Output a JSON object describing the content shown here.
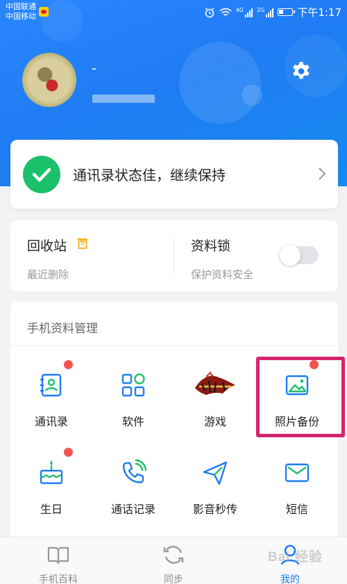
{
  "status_bar": {
    "carrier_1": "中国联通",
    "carrier_2": "中国移动",
    "net_1": "4G",
    "net_2": "2G",
    "time": "下午1:17"
  },
  "profile": {
    "username": "-",
    "settings_icon": "gear-icon"
  },
  "status_card": {
    "text": "通讯录状态佳，继续保持",
    "accent": "#1cc06b"
  },
  "utilities": {
    "recycle": {
      "title": "回收站",
      "subtitle": "最近删除",
      "icon": "trash-icon",
      "icon_color": "#f5b623"
    },
    "lock": {
      "title": "资料锁",
      "subtitle": "保护资料安全",
      "enabled": false
    }
  },
  "management": {
    "title": "手机资料管理",
    "items": [
      {
        "label": "通讯录",
        "icon": "contacts-icon",
        "badge": true
      },
      {
        "label": "软件",
        "icon": "apps-icon",
        "badge": false
      },
      {
        "label": "游戏",
        "icon": "game-logo-icon",
        "badge": false
      },
      {
        "label": "照片备份",
        "icon": "photo-icon",
        "badge": true
      },
      {
        "label": "生日",
        "icon": "birthday-cake-icon",
        "badge": true
      },
      {
        "label": "通话记录",
        "icon": "phone-icon",
        "badge": false
      },
      {
        "label": "影音秒传",
        "icon": "send-icon",
        "badge": false
      },
      {
        "label": "短信",
        "icon": "mail-icon",
        "badge": false
      }
    ]
  },
  "bottom_nav": [
    {
      "label": "手机百科",
      "icon": "book-icon",
      "active": false
    },
    {
      "label": "同步",
      "icon": "sync-icon",
      "active": false
    },
    {
      "label": "我的",
      "icon": "profile-icon",
      "active": true
    }
  ],
  "watermark": "Bai 经验",
  "colors": {
    "brand_blue": "#1f7cf3",
    "badge_red": "#f4544b",
    "highlight": "#d6246e"
  }
}
